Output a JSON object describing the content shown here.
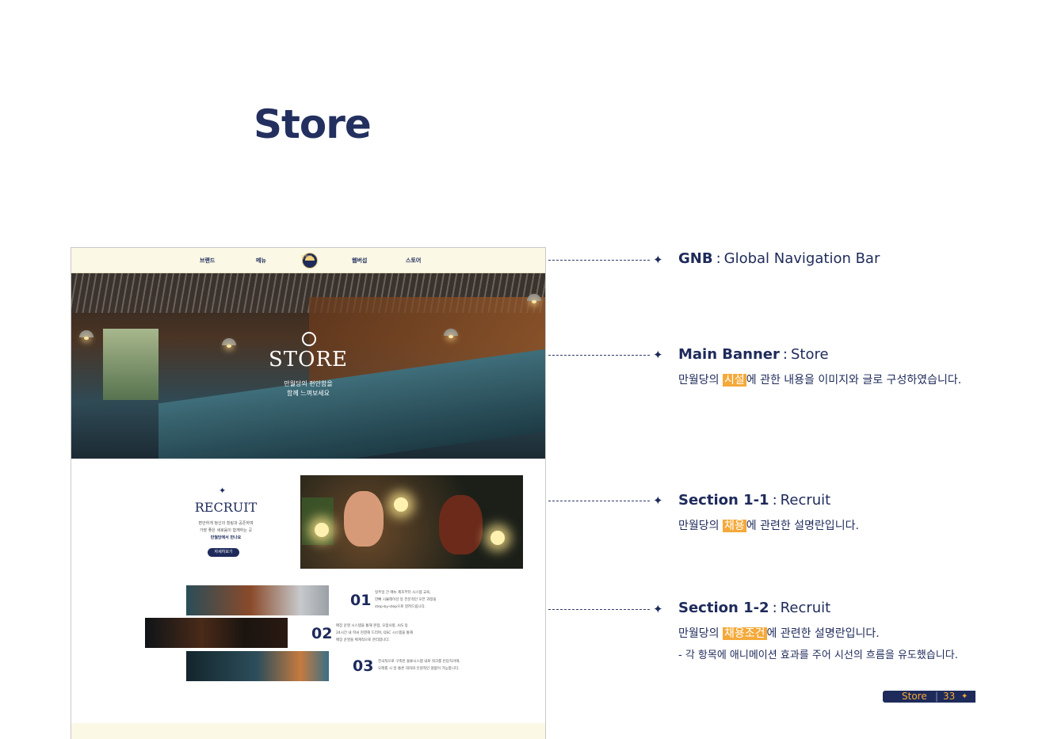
{
  "page": {
    "title": "Store"
  },
  "mockup": {
    "gnb": {
      "items": [
        "브랜드",
        "메뉴",
        "웹버섭",
        "스토어"
      ],
      "logo_text": "만월당"
    },
    "banner": {
      "title": "STORE",
      "subtitle_lines": [
        "만월당의 편안함을",
        "함께 느껴보세요"
      ]
    },
    "recruit": {
      "title": "RECRUIT",
      "lines": [
        "편안하게 정신의 힐링과 공존하며",
        "가장 좋은 새로움이 함께하는 곳",
        "만월당에서 만나요"
      ],
      "button_label": "자세히보기"
    },
    "steps": [
      {
        "number": "01",
        "lines": [
          "일주일 간 매뉴 제조부터 시스템 교육,",
          "한뼈 시뮬레이션 등 전문적인 오픈 과정을",
          "step-by-step으로 알려드립니다."
        ]
      },
      {
        "number": "02",
        "lines": [
          "매장 운영 시스템을 통해 본점, 오점사항, A/S 등",
          "24시간 내 학씨 현결해 드리며, QSC 시스템을 통해",
          "매장 운영을 체계적으로 관리합니다."
        ]
      },
      {
        "number": "03",
        "lines": [
          "전국적으로 구축된 물류시스템 내로 워크를 빈당자거에,",
          "오래를 시 일 통론 대처와 인원적인 않없이 가능합니다."
        ]
      }
    ]
  },
  "annotations": [
    {
      "label": "GNB",
      "separator": ":",
      "value": "Global Navigation Bar"
    },
    {
      "label": "Main Banner",
      "separator": ":",
      "value": "Store",
      "sub": {
        "before": "만월당의 ",
        "highlight": "시설",
        "after": "에 관한 내용을 이미지와 글로 구성하였습니다."
      }
    },
    {
      "label": "Section 1-1",
      "separator": ":",
      "value": "Recruit",
      "sub": {
        "before": "만월당의 ",
        "highlight": "채용",
        "after": "에 관련한 설명란입니다."
      }
    },
    {
      "label": "Section 1-2",
      "separator": ":",
      "value": "Recruit",
      "sub": {
        "before": "만월당의 ",
        "highlight": "채용조건",
        "after": "에 관련한 설명란입니다."
      },
      "note": "- 각 항목에 애니메이션 효과를 주어 시선의 흐름을 유도했습니다."
    }
  ],
  "footer": {
    "section": "Store",
    "divider": "|",
    "page_number": "33",
    "mark": "✦"
  },
  "icons": {
    "sparkle": "sparkle-icon"
  },
  "colors": {
    "navy": "#1e2a5a",
    "highlight": "#f4a93a",
    "cream": "#fbf8e6"
  }
}
